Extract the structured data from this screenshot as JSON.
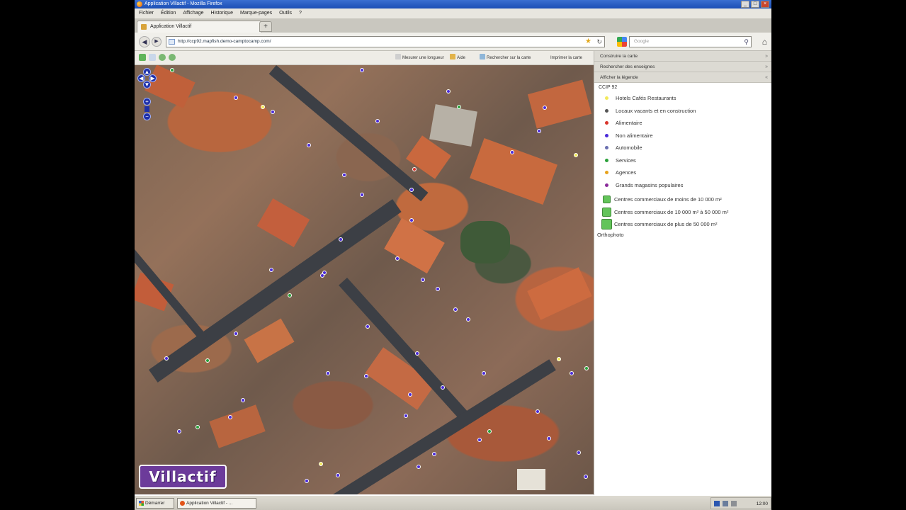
{
  "window": {
    "title": "Application Villactif - Mozilla Firefox"
  },
  "menu": [
    "Fichier",
    "Édition",
    "Affichage",
    "Historique",
    "Marque-pages",
    "Outils",
    "?"
  ],
  "tab": {
    "label": "Application Villactif",
    "new_tab": "+"
  },
  "nav": {
    "url": "http://ccp92.mapfish.demo-camptocamp.com/",
    "search_placeholder": "Google",
    "back": "◀",
    "forward": "▶",
    "home": "⌂"
  },
  "map_toolbar": {
    "tools": [
      "Mesurer une longueur",
      "Aide",
      "Rechercher sur la carte",
      "Imprimer la carte"
    ]
  },
  "map": {
    "pan": [
      "▲",
      "◀",
      "▶",
      "▼"
    ],
    "zoom_in": "+",
    "zoom_out": "−",
    "logo": "Villactif"
  },
  "sidepanel": {
    "sections": [
      "Construire la carte",
      "Rechercher des enseignes",
      "Afficher la légende"
    ],
    "layer": "CCIP 92",
    "legend": [
      {
        "label": "Hotels Cafés Restaurants",
        "color": "#f2e95a",
        "kind": "dot"
      },
      {
        "label": "Locaux vacants et en construction",
        "color": "#555555",
        "kind": "dot"
      },
      {
        "label": "Alimentaire",
        "color": "#d9342b",
        "kind": "dot"
      },
      {
        "label": "Non alimentaire",
        "color": "#4a2bd9",
        "kind": "dot"
      },
      {
        "label": "Automobile",
        "color": "#6a6fb0",
        "kind": "dot"
      },
      {
        "label": "Services",
        "color": "#2aa13a",
        "kind": "dot"
      },
      {
        "label": "Agences",
        "color": "#e7a21c",
        "kind": "dot"
      },
      {
        "label": "Grands magasins populaires",
        "color": "#8a2b9a",
        "kind": "dot"
      },
      {
        "label": "Centres commerciaux de moins de 10 000 m²",
        "color": "#63c45a",
        "kind": "sq1"
      },
      {
        "label": "Centres commerciaux de 10 000 m² à 50 000 m²",
        "color": "#63c45a",
        "kind": "sq2"
      },
      {
        "label": "Centres commerciaux de plus de 50 000 m²",
        "color": "#63c45a",
        "kind": "sq3"
      }
    ],
    "basemap": "Orthophoto"
  },
  "taskbar": {
    "start": "Démarrer",
    "app": "Application Villactif - ...",
    "clock": "12:00"
  }
}
